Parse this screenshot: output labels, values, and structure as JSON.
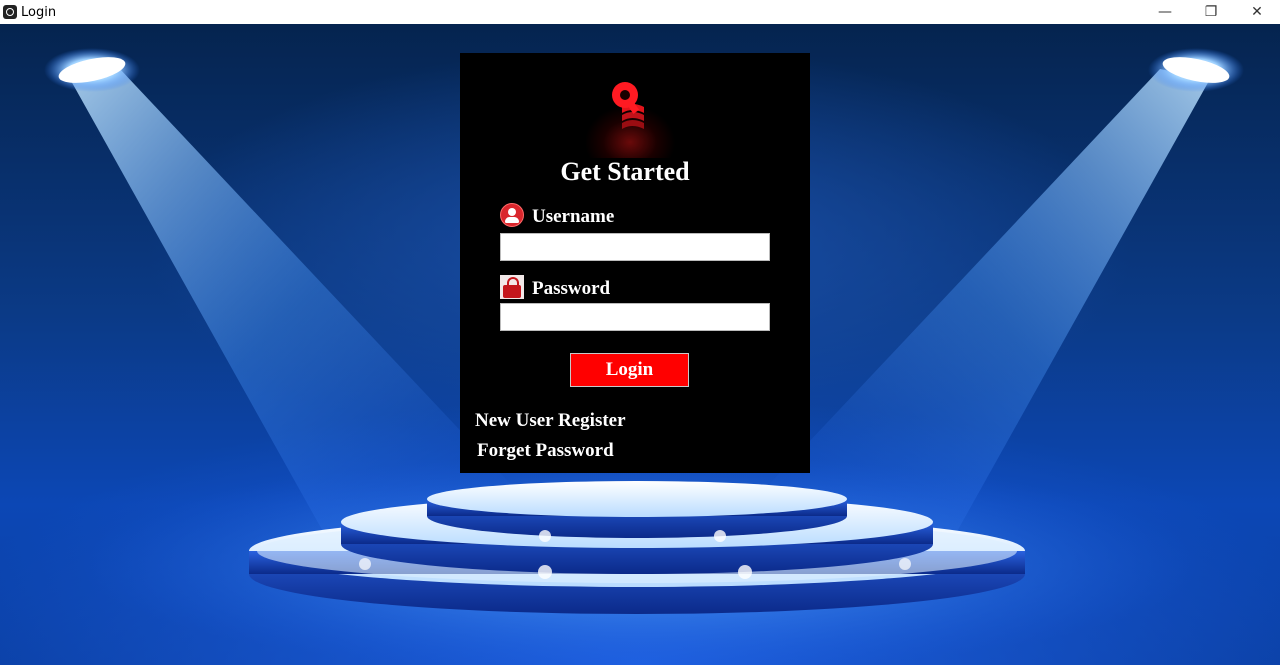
{
  "window": {
    "title": "Login",
    "controls": {
      "minimize": "—",
      "restore": "❐",
      "close": "✕"
    }
  },
  "login_form": {
    "heading": "Get Started",
    "username": {
      "label": "Username",
      "value": "",
      "placeholder": ""
    },
    "password": {
      "label": "Password",
      "value": "",
      "placeholder": ""
    },
    "login_button": "Login",
    "register_link": "New User Register",
    "forgot_link": "Forget Password"
  },
  "icons": {
    "logo": "key-logo-icon",
    "username": "user-icon",
    "password": "lock-icon"
  },
  "colors": {
    "panel_bg": "#000000",
    "button_bg": "#ff0000",
    "text": "#ffffff",
    "stage_blue": "#0b3a86",
    "logo_red": "#e3141b"
  }
}
